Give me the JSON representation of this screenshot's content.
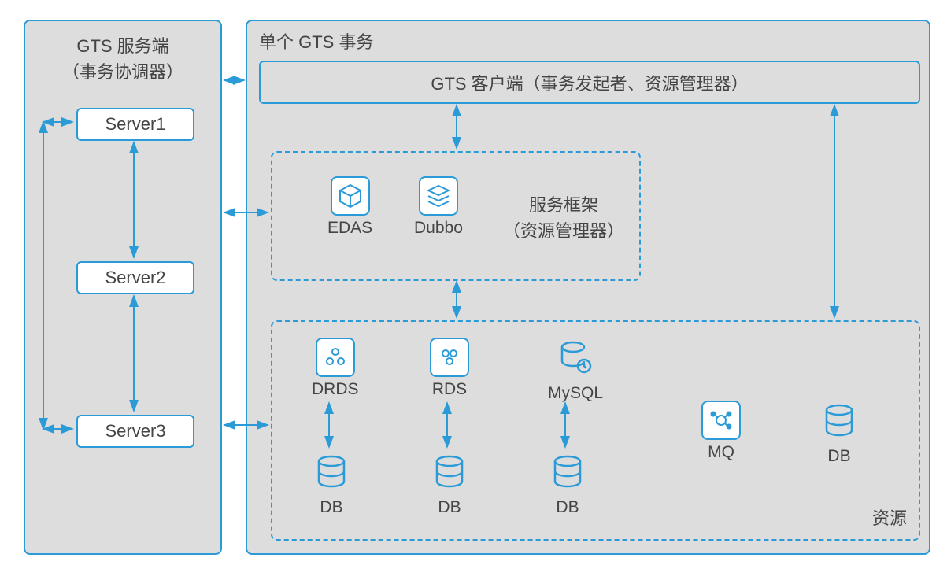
{
  "left_panel": {
    "title_line1": "GTS 服务端",
    "title_line2": "（事务协调器）",
    "server1": "Server1",
    "server2": "Server2",
    "server3": "Server3"
  },
  "right_panel": {
    "title": "单个 GTS 事务",
    "client_label": "GTS 客户端（事务发起者、资源管理器）",
    "framework": {
      "edas": "EDAS",
      "dubbo": "Dubbo",
      "title_line1": "服务框架",
      "title_line2": "（资源管理器）"
    },
    "resources": {
      "drds": "DRDS",
      "rds": "RDS",
      "mysql": "MySQL",
      "mq": "MQ",
      "db_right": "DB",
      "db1": "DB",
      "db2": "DB",
      "db3": "DB",
      "title": "资源"
    }
  },
  "colors": {
    "border": "#2b9bd8",
    "fill": "#dddddd"
  }
}
